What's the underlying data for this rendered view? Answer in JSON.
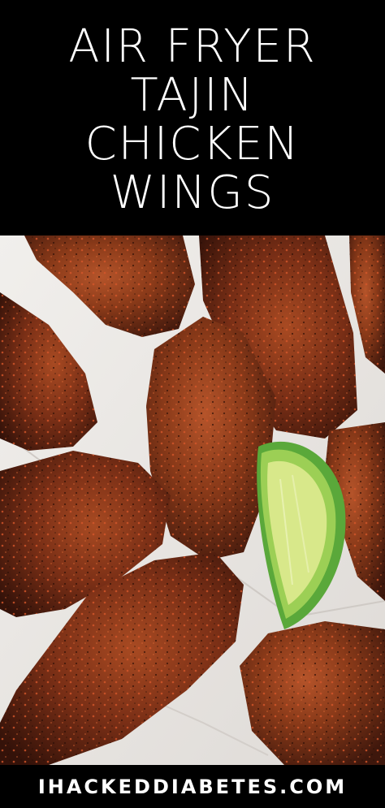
{
  "title": {
    "lines": [
      "AIR FRYER",
      "TAJIN",
      "CHICKEN",
      "WINGS"
    ]
  },
  "footer": {
    "site": "IHACKEDDIABETES.COM"
  },
  "photo": {
    "subject": "photo-of-seasoned-chicken-wings-with-lime",
    "colors": {
      "parchment": "#ece9e6",
      "wing_dark": "#4a1d10",
      "wing_mid": "#7a2f16",
      "wing_highlight": "#b5542a",
      "lime_peel": "#5aa83a",
      "lime_flesh": "#d8e88a"
    }
  }
}
